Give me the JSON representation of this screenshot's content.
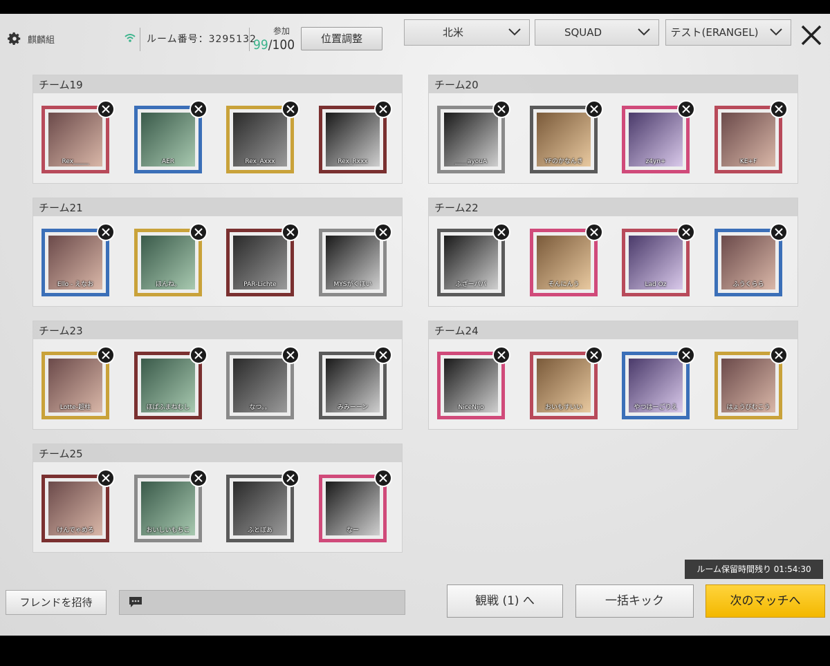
{
  "header": {
    "team_name": "麒麟組",
    "room_label": "ルーム番号：",
    "room_number": "3295132",
    "join_label": "参加",
    "count_current": "99",
    "count_max": "/100",
    "position_button": "位置調整",
    "region": "北米",
    "mode": "SQUAD",
    "map": "テスト(ERANGEL)"
  },
  "teams": [
    {
      "title": "チーム19",
      "players": [
        "Rex_____",
        "AER",
        "Rex_Axxx",
        "Rex_Rxxx"
      ]
    },
    {
      "title": "チーム20",
      "players": [
        "____ayouA",
        "YFのかなんき",
        "z4yn+",
        "KE+F"
      ]
    },
    {
      "title": "チーム21",
      "players": [
        "Ello - えなお",
        "ほんね。",
        "PAR-Lichte",
        "MYSがくほい"
      ]
    },
    {
      "title": "チーム22",
      "players": [
        "ふざーパパ",
        "そんにんう",
        "Lad Oz",
        "ふうくらら"
      ]
    },
    {
      "title": "チーム23",
      "players": [
        "Lotte-超柱",
        "ほぱふまねむし",
        "なつ。。",
        "みみーーン"
      ]
    },
    {
      "title": "チーム24",
      "players": [
        "NiceNijo",
        "おいもすいい",
        "やつはーごりえ",
        "はょうびむこう"
      ]
    },
    {
      "title": "チーム25",
      "players": [
        "けんでゃめろ",
        "おいしいもちこ",
        "ふとぼあ",
        "なー"
      ]
    }
  ],
  "footer": {
    "invite_button": "フレンドを招待",
    "spectate_button": "観戦 (1) へ",
    "kick_all_button": "一括キック",
    "next_match_button": "次のマッチへ",
    "room_timer": "ルーム保留時間残り 01:54:30"
  },
  "colors": {
    "accent_yellow": "#f3b800",
    "player_count_green": "#3cb48c"
  }
}
